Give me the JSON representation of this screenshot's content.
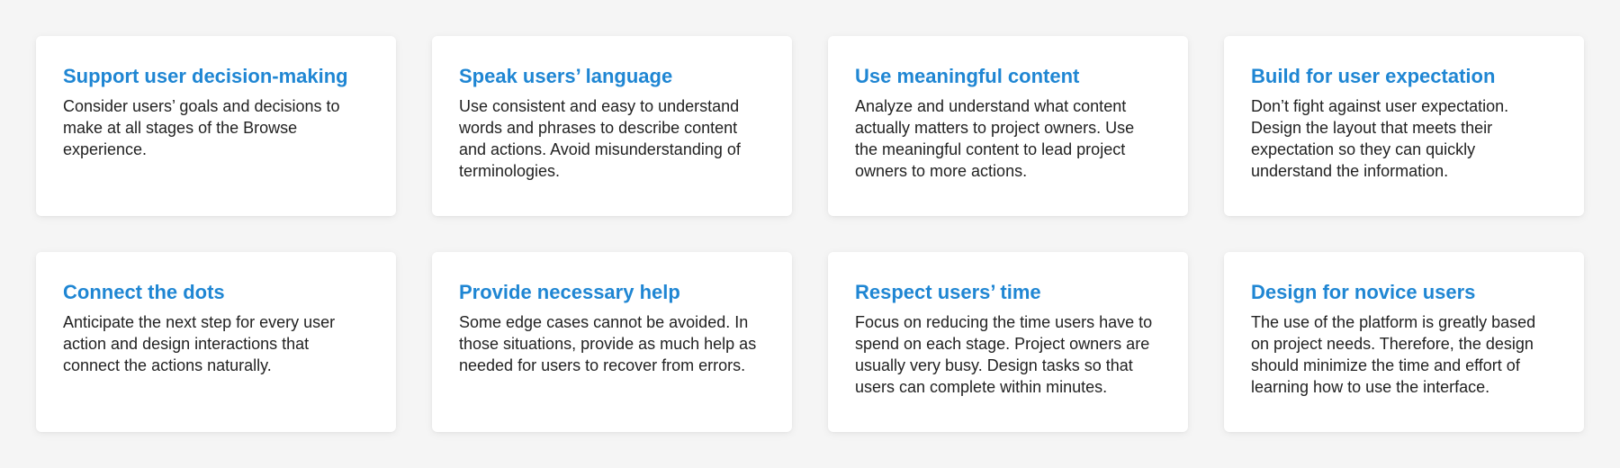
{
  "accent_color": "#1f86d3",
  "principles": [
    {
      "title": "Support user decision-making",
      "body": "Consider users’ goals and decisions to make at all stages of the Browse experience."
    },
    {
      "title": "Speak users’ language",
      "body": "Use consistent and easy to understand words and phrases to describe content and actions. Avoid misunderstanding of terminologies."
    },
    {
      "title": "Use meaningful content",
      "body": "Analyze and understand what content actually matters to project owners. Use the meaningful content to lead project owners to more actions."
    },
    {
      "title": "Build for user expectation",
      "body": "Don’t fight against user expectation. Design the layout that meets their expectation so they can quickly understand the information."
    },
    {
      "title": "Connect the dots",
      "body": "Anticipate the next step for every user action and design interactions that connect the actions naturally."
    },
    {
      "title": "Provide necessary help",
      "body": "Some edge cases cannot be avoided. In those situations, provide as much help as needed for users to recover from errors."
    },
    {
      "title": "Respect users’ time",
      "body": "Focus on reducing the time users have to spend on each stage. Project owners are usually very busy.  Design tasks so that users can complete within minutes."
    },
    {
      "title": "Design for novice users",
      "body": "The use of the platform is greatly based on project needs. Therefore, the design should minimize the time and effort of learning how to use the interface."
    }
  ]
}
